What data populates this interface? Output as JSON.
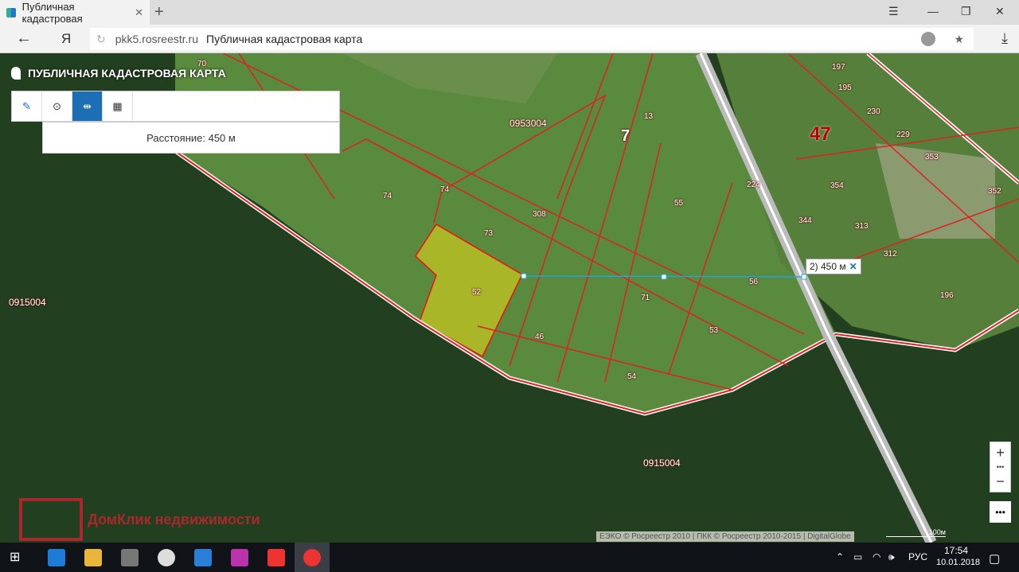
{
  "browser": {
    "tab_title": "Публичная кадастровая",
    "url_domain": "pkk5.rosreestr.ru",
    "page_title": "Публичная кадастровая карта"
  },
  "app": {
    "title": "ПУБЛИЧНАЯ КАДАСТРОВАЯ КАРТА",
    "distance_text": "Расстояние: 450 м",
    "measure_label": "2) 450 м"
  },
  "map": {
    "parcels": [
      {
        "t": "70",
        "c": "#fff"
      },
      {
        "t": "74",
        "c": "#fff"
      },
      {
        "t": "74",
        "c": "#fff"
      },
      {
        "t": "73",
        "c": "#fff"
      },
      {
        "t": "308",
        "c": "#fff"
      },
      {
        "t": "13",
        "c": "#fff"
      },
      {
        "t": "0953004",
        "c": "#fff"
      },
      {
        "t": "55",
        "c": "#fff"
      },
      {
        "t": "224",
        "c": "#fff"
      },
      {
        "t": "344",
        "c": "#fff"
      },
      {
        "t": "197",
        "c": "#fff"
      },
      {
        "t": "195",
        "c": "#fff"
      },
      {
        "t": "230",
        "c": "#fff"
      },
      {
        "t": "229",
        "c": "#fff"
      },
      {
        "t": "353",
        "c": "#fff"
      },
      {
        "t": "354",
        "c": "#fff"
      },
      {
        "t": "352",
        "c": "#fff"
      },
      {
        "t": "313",
        "c": "#fff"
      },
      {
        "t": "312",
        "c": "#fff"
      },
      {
        "t": "196",
        "c": "#fff"
      },
      {
        "t": "56",
        "c": "#fff"
      },
      {
        "t": "71",
        "c": "#fff"
      },
      {
        "t": "53",
        "c": "#fff"
      },
      {
        "t": "52",
        "c": "#fff"
      },
      {
        "t": "46",
        "c": "#fff"
      },
      {
        "t": "54",
        "c": "#fff"
      },
      {
        "t": "0915004",
        "c": "#fff"
      },
      {
        "t": "0915004",
        "c": "#fff"
      }
    ],
    "big_labels": [
      "7",
      "47"
    ],
    "attribution": "ЕЭКО © Росреестр 2010 | ПКК © Росреестр 2010-2015 | DigitalGlobe",
    "scale": "100м",
    "watermark": "ДомКлик недвижимости",
    "zoom_in": "+",
    "zoom_out": "−",
    "more": "•••"
  },
  "taskbar": {
    "lang": "РУС",
    "time": "17:54",
    "date": "10.01.2018"
  }
}
